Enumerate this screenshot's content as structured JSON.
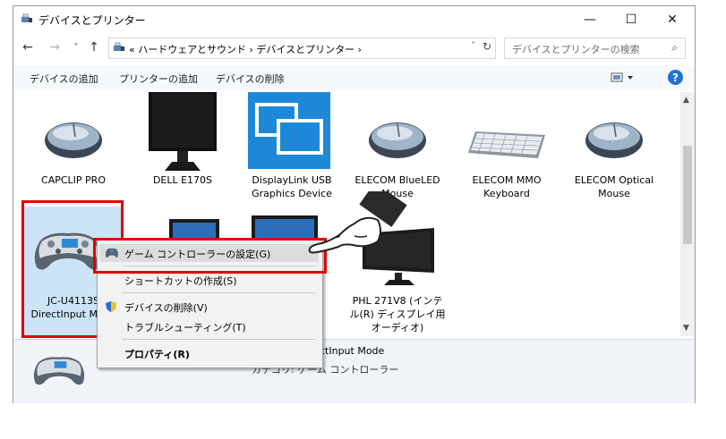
{
  "window": {
    "title": "デバイスとプリンター"
  },
  "window_controls": {
    "minimize": "—",
    "maximize": "☐",
    "close": "✕"
  },
  "nav": {
    "back": "←",
    "forward": "→",
    "recent": "˅",
    "up": "↑"
  },
  "address": {
    "text": "« ハードウェアとサウンド › デバイスとプリンター ›",
    "dropdown": "˅",
    "refresh": "↻"
  },
  "search": {
    "placeholder": "デバイスとプリンターの検索",
    "icon": "⌕"
  },
  "toolbar": {
    "add_device": "デバイスの追加",
    "add_printer": "プリンターの追加",
    "remove_device": "デバイスの削除",
    "help": "?"
  },
  "devices": [
    {
      "label": "CAPCLIP PRO",
      "icon": "mouse-icon"
    },
    {
      "label": "DELL E170S",
      "icon": "monitor-icon"
    },
    {
      "label": "DisplayLink USB Graphics Device",
      "icon": "displaylink-icon"
    },
    {
      "label": "ELECOM BlueLED Mouse",
      "icon": "mouse-icon"
    },
    {
      "label": "ELECOM MMO Keyboard",
      "icon": "keyboard-icon"
    },
    {
      "label": "ELECOM Optical Mouse",
      "icon": "mouse-icon"
    },
    {
      "label": "JC-U4113S DirectInput Mode",
      "icon": "gamepad-icon"
    },
    {
      "label": "PHL 271V8 (インテル(R) ディスプレイ用オーディオ)",
      "icon": "monitor-icon"
    }
  ],
  "context_menu": {
    "game_controller_settings": "ゲーム コントローラーの設定(G)",
    "create_shortcut": "ショートカットの作成(S)",
    "remove_device": "デバイスの削除(V)",
    "troubleshoot": "トラブルシューティング(T)",
    "properties": "プロパティ(R)"
  },
  "details": {
    "name": "JC-U4113S DirectInput Mode",
    "category": "カテゴリ: ゲーム コントローラー"
  },
  "colors": {
    "highlight": "#e00000",
    "accent": "#1e73d8",
    "selected_bg": "#cce4f7"
  }
}
